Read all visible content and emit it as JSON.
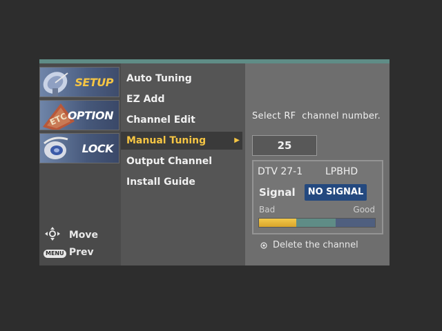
{
  "tabs": [
    {
      "label": "SETUP",
      "icon": "satellite-dish-icon"
    },
    {
      "label": "OPTION",
      "icon": "etc-icon"
    },
    {
      "label": "LOCK",
      "icon": "lock-icon"
    }
  ],
  "hints": {
    "move": "Move",
    "menu_key": "MENU",
    "prev": "Prev"
  },
  "menu": {
    "items": [
      {
        "label": "Auto Tuning"
      },
      {
        "label": "EZ Add"
      },
      {
        "label": "Channel Edit"
      },
      {
        "label": "Manual Tuning",
        "selected": true
      },
      {
        "label": "Output Channel"
      },
      {
        "label": "Install Guide"
      }
    ]
  },
  "panel": {
    "prompt": "Select RF  channel number.",
    "channel_value": "25",
    "dtv": "DTV 27-1",
    "station": "LPBHD",
    "signal_label": "Signal",
    "signal_status": "NO SIGNAL",
    "bad_label": "Bad",
    "good_label": "Good",
    "signal_level": 0.32,
    "delete_text": "Delete the channel"
  },
  "colors": {
    "accent": "#f5c544",
    "top_bar": "#5f8c86",
    "no_signal_bg": "#24497f"
  }
}
